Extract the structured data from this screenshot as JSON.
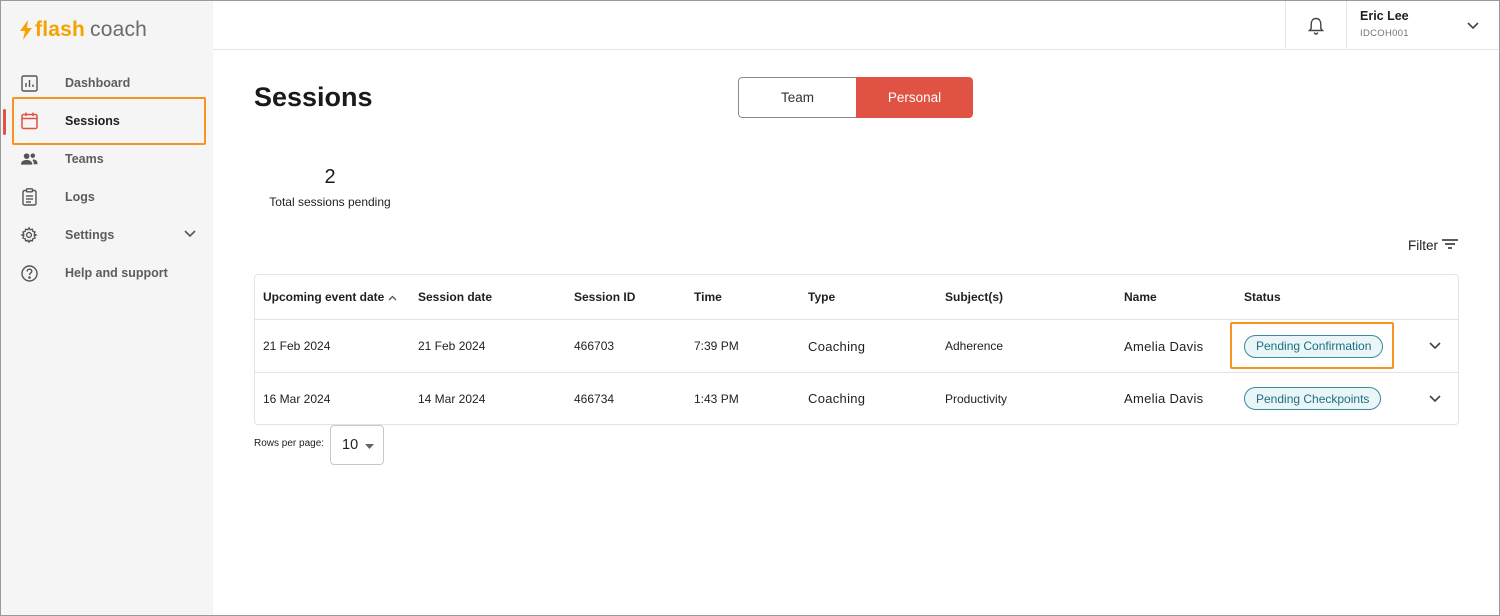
{
  "app": {
    "logo_flash": "flash",
    "logo_coach": "coach",
    "brand_color": "#f5a300",
    "accent_color": "#e05244",
    "highlight_color": "#f7941d"
  },
  "sidebar": {
    "items": [
      {
        "label": "Dashboard",
        "icon": "bar-chart-icon",
        "active": false
      },
      {
        "label": "Sessions",
        "icon": "calendar-icon",
        "active": true
      },
      {
        "label": "Teams",
        "icon": "people-icon",
        "active": false
      },
      {
        "label": "Logs",
        "icon": "clipboard-icon",
        "active": false
      },
      {
        "label": "Settings",
        "icon": "gear-icon",
        "active": false,
        "expandable": true
      },
      {
        "label": "Help and support",
        "icon": "help-circle-icon",
        "active": false
      }
    ]
  },
  "topbar": {
    "notification_icon": "bell-icon",
    "user_name": "Eric Lee",
    "user_id": "IDCOH001"
  },
  "main": {
    "title": "Sessions",
    "toggle": {
      "team": "Team",
      "personal": "Personal",
      "selected": "Personal"
    },
    "stat": {
      "value": "2",
      "label": "Total sessions pending"
    },
    "filter_label": "Filter"
  },
  "table": {
    "columns": [
      "Upcoming event date",
      "Session date",
      "Session ID",
      "Time",
      "Type",
      "Subject(s)",
      "Name",
      "Status"
    ],
    "sorted_column": "Upcoming event date",
    "rows": [
      {
        "upcoming": "21 Feb 2024",
        "session_date": "21 Feb 2024",
        "session_id": "466703",
        "time": "7:39 PM",
        "type": "Coaching",
        "subject": "Adherence",
        "name": "Amelia Davis",
        "status": "Pending Confirmation"
      },
      {
        "upcoming": "16 Mar 2024",
        "session_date": "14 Mar 2024",
        "session_id": "466734",
        "time": "1:43 PM",
        "type": "Coaching",
        "subject": "Productivity",
        "name": "Amelia Davis",
        "status": "Pending Checkpoints"
      }
    ]
  },
  "pagination": {
    "rows_per_page_label": "Rows per page:",
    "rows_per_page_value": "10"
  }
}
